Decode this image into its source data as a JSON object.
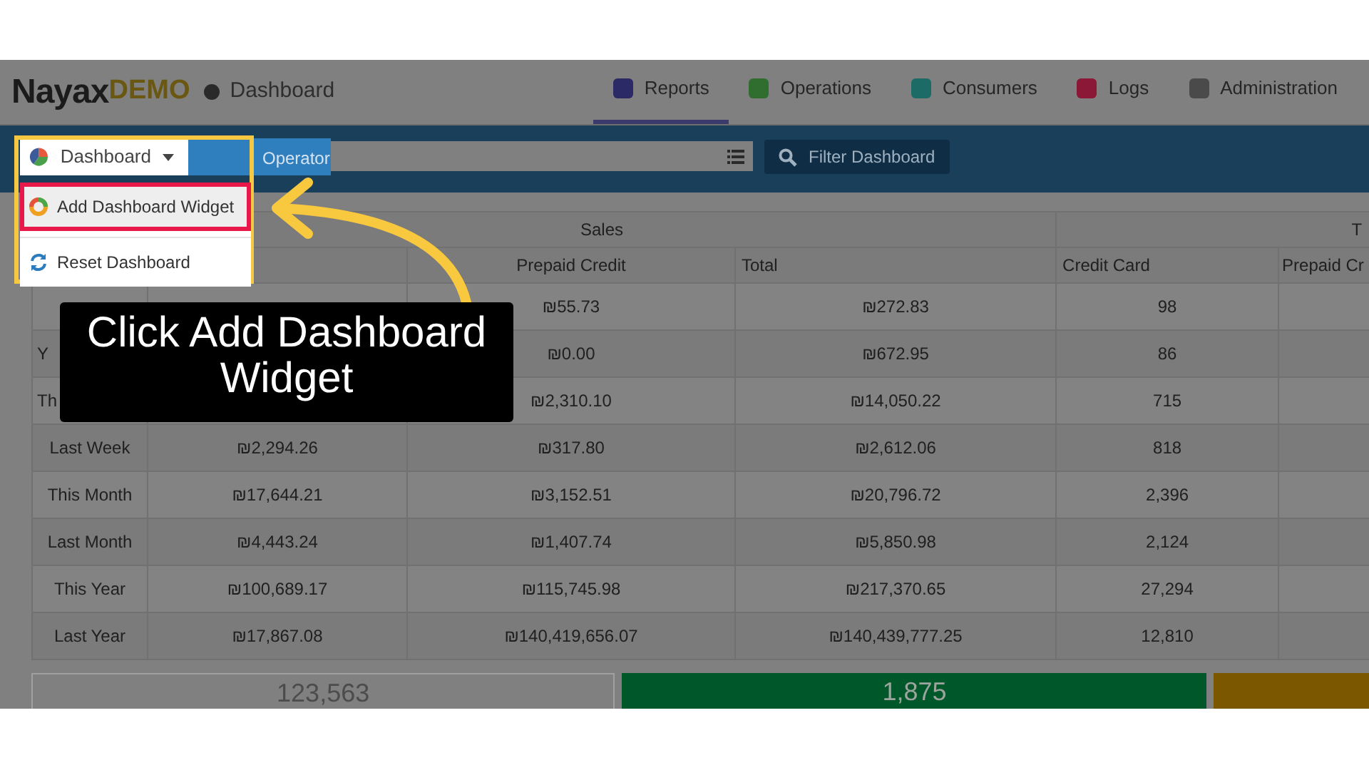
{
  "brand": {
    "logo": "Nayax",
    "logo_suffix": "DEMO",
    "page": "Dashboard"
  },
  "tabs": [
    {
      "label": "Reports",
      "selected": true,
      "color": "#2b2a66"
    },
    {
      "label": "Operations",
      "selected": false,
      "color": "#2f6e2f"
    },
    {
      "label": "Consumers",
      "selected": false,
      "color": "#1d6b66"
    },
    {
      "label": "Logs",
      "selected": false,
      "color": "#8a1836"
    },
    {
      "label": "Administration",
      "selected": false,
      "color": "#4a4a4a"
    }
  ],
  "toolbar": {
    "dashboard_button": "Dashboard",
    "operator_label": "Operator",
    "filter_button": "Filter Dashboard"
  },
  "dropdown_menu": {
    "items": [
      {
        "label": "Add Dashboard Widget",
        "kind": "add",
        "highlighted": true
      },
      {
        "label": "Reset Dashboard",
        "kind": "reset",
        "highlighted": false
      }
    ]
  },
  "table": {
    "groups": [
      "Sales",
      "T"
    ],
    "columns": [
      null,
      null,
      "Prepaid Credit",
      "Total",
      "Credit Card",
      "Prepaid Cr"
    ],
    "rows": [
      {
        "cells": [
          null,
          null,
          "₪55.73",
          "₪272.83",
          "98",
          null
        ]
      },
      {
        "label_cut": true,
        "cells": [
          "Y",
          null,
          "₪0.00",
          "₪672.95",
          "86",
          null
        ]
      },
      {
        "label_cut": true,
        "cells": [
          "Th",
          null,
          "₪2,310.10",
          "₪14,050.22",
          "715",
          null
        ]
      },
      {
        "label_cut": false,
        "cells": [
          "Last Week",
          "₪2,294.26",
          "₪317.80",
          "₪2,612.06",
          "818",
          null
        ]
      },
      {
        "label_cut": false,
        "cells": [
          "This Month",
          "₪17,644.21",
          "₪3,152.51",
          "₪20,796.72",
          "2,396",
          null
        ]
      },
      {
        "label_cut": false,
        "cells": [
          "Last Month",
          "₪4,443.24",
          "₪1,407.74",
          "₪5,850.98",
          "2,124",
          null
        ]
      },
      {
        "label_cut": false,
        "cells": [
          "This Year",
          "₪100,689.17",
          "₪115,745.98",
          "₪217,370.65",
          "27,294",
          null
        ]
      },
      {
        "label_cut": false,
        "cells": [
          "Last Year",
          "₪17,867.08",
          "₪140,419,656.07",
          "₪140,439,777.25",
          "12,810",
          null
        ]
      }
    ]
  },
  "summary_cards": [
    {
      "kind": "plain",
      "value": "123,563"
    },
    {
      "kind": "green",
      "value": "1,875"
    },
    {
      "kind": "gold"
    }
  ],
  "callout": {
    "text": "Click Add Dashboard Widget"
  }
}
